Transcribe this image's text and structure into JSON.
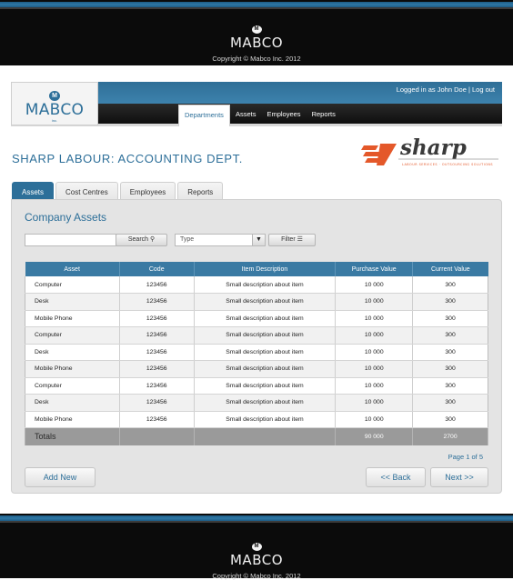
{
  "footer_top": {
    "logo_text": "MABCO",
    "badge": "M",
    "copyright": "Copyright © Mabco Inc. 2012"
  },
  "header": {
    "logo_text": "MABCO",
    "logo_badge": "M",
    "logo_sub": "inc.",
    "user_line": "Logged in as  John Doe  |  Log out",
    "nav": [
      "Departments",
      "Assets",
      "Employees",
      "Reports"
    ],
    "nav_active": "Departments"
  },
  "page_title": "SHARP LABOUR: ACCOUNTING DEPT.",
  "brand_logo": {
    "text": "sharp",
    "tagline": "LABOUR SERVICES · OUTSOURCING SOLUTIONS",
    "color": "#e4582a"
  },
  "tabs": [
    "Assets",
    "Cost Centres",
    "Employees",
    "Reports"
  ],
  "tab_active": "Assets",
  "panel": {
    "title": "Company Assets",
    "search_placeholder": "",
    "search_button": "Search",
    "type_select": "Type",
    "filter_button": "Filter"
  },
  "table": {
    "headers": [
      "Asset",
      "Code",
      "Item Description",
      "Purchase Value",
      "Current Value"
    ],
    "rows": [
      [
        "Computer",
        "123456",
        "Small description about item",
        "10 000",
        "300"
      ],
      [
        "Desk",
        "123456",
        "Small description about item",
        "10 000",
        "300"
      ],
      [
        "Mobile Phone",
        "123456",
        "Small description about item",
        "10 000",
        "300"
      ],
      [
        "Computer",
        "123456",
        "Small description about item",
        "10 000",
        "300"
      ],
      [
        "Desk",
        "123456",
        "Small description about item",
        "10 000",
        "300"
      ],
      [
        "Mobile Phone",
        "123456",
        "Small description about item",
        "10 000",
        "300"
      ],
      [
        "Computer",
        "123456",
        "Small description about item",
        "10 000",
        "300"
      ],
      [
        "Desk",
        "123456",
        "Small description about item",
        "10 000",
        "300"
      ],
      [
        "Mobile Phone",
        "123456",
        "Small description about item",
        "10 000",
        "300"
      ]
    ],
    "totals": [
      "Totals",
      "",
      "",
      "90 000",
      "2700"
    ]
  },
  "pagination": "Page 1 of 5",
  "buttons": {
    "add_new": "Add New",
    "back": "<< Back",
    "next": "Next >>"
  },
  "footer_bottom": {
    "logo_text": "MABCO",
    "badge": "M",
    "copyright": "Copyright © Mabco Inc. 2012"
  },
  "colors": {
    "primary": "#2d6f99",
    "header_blue": "#3a7aa3",
    "brand_orange": "#e4582a",
    "dark": "#0b0b0b"
  }
}
